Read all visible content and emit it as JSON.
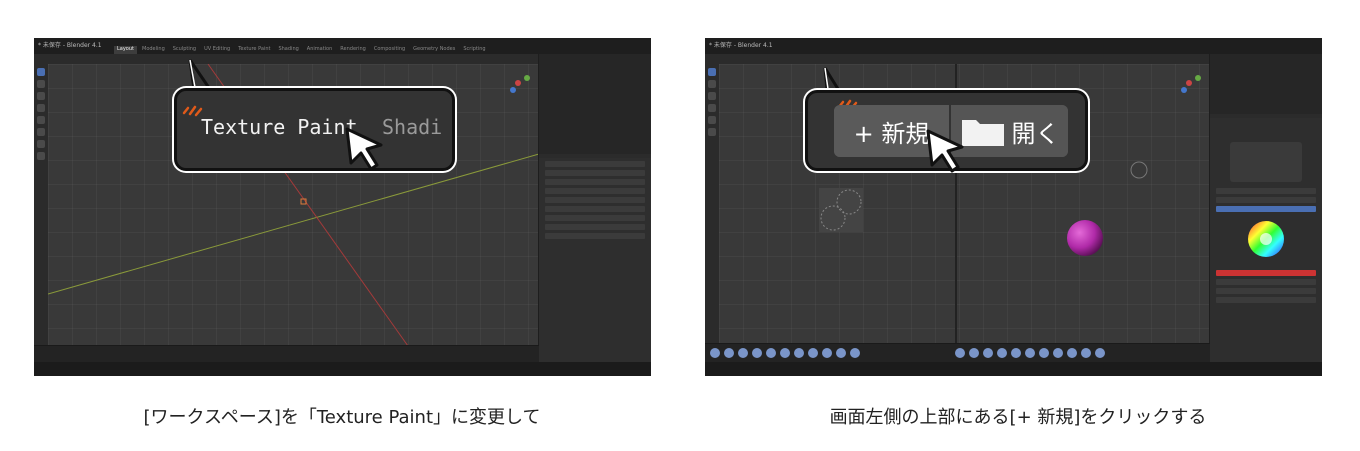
{
  "left": {
    "window_title": "* 未保存 - Blender 4.1",
    "workspace_tabs": [
      "Layout",
      "Modeling",
      "Sculpting",
      "UV Editing",
      "Texture Paint",
      "Shading",
      "Animation",
      "Rendering",
      "Compositing",
      "Geometry Nodes",
      "Scripting"
    ],
    "active_tab": "Layout",
    "callout": {
      "label": "Texture Paint",
      "next_label": "Shadi"
    }
  },
  "right": {
    "window_title": "* 未保存 - Blender 4.1",
    "callout": {
      "new_label": "+ 新規",
      "open_label": "開く"
    }
  },
  "captions": {
    "left": "[ワークスペース]を「Texture Paint」に変更して",
    "right": "画面左側の上部にある[+ 新規]をクリックする"
  },
  "colors": {
    "sphere": "#b02aa8",
    "accent_blue": "#4a6fb3",
    "sketch_orange": "#e05a1a"
  }
}
